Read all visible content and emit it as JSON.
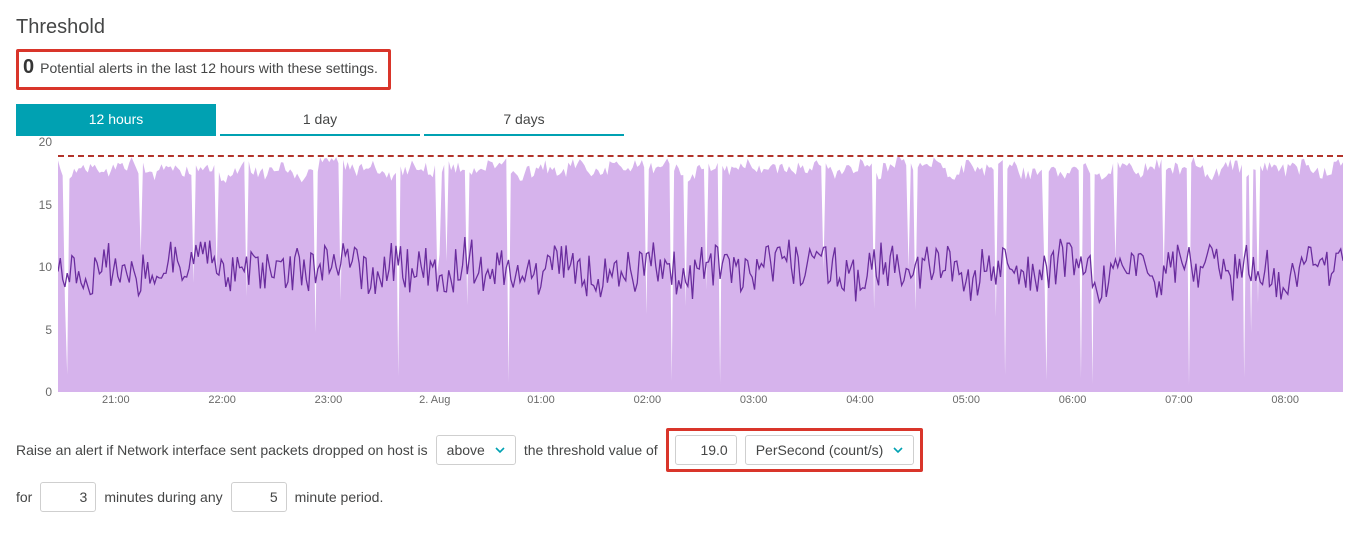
{
  "title": "Threshold",
  "alert": {
    "count": "0",
    "text": "Potential alerts in the last 12 hours with these settings."
  },
  "tabs": [
    {
      "label": "12 hours",
      "active": true
    },
    {
      "label": "1 day",
      "active": false
    },
    {
      "label": "7 days",
      "active": false
    }
  ],
  "chart_data": {
    "type": "line",
    "title": "",
    "xlabel": "",
    "ylabel": "",
    "ylim": [
      0,
      20
    ],
    "y_ticks": [
      0,
      5,
      10,
      15,
      20
    ],
    "x_ticks": [
      "21:00",
      "22:00",
      "23:00",
      "2. Aug",
      "01:00",
      "02:00",
      "03:00",
      "04:00",
      "05:00",
      "06:00",
      "07:00",
      "08:00"
    ],
    "threshold": 19.0,
    "series": [
      {
        "name": "range",
        "role": "area-max",
        "values": [
          18.6,
          17.9,
          18.8,
          18.2,
          18.9,
          18.0,
          18.7,
          18.3,
          18.9,
          17.8,
          18.8,
          18.1,
          18.9,
          17.7,
          18.8,
          18.9,
          18.2,
          18.9,
          17.6,
          18.8,
          18.3,
          18.9,
          18.0,
          18.7,
          18.9,
          17.9,
          18.8,
          18.2,
          18.9,
          18.1,
          18.7,
          18.9,
          18.4,
          18.9,
          17.8,
          18.8,
          18.2,
          18.9,
          18.0,
          18.7,
          18.3,
          18.9,
          17.9,
          18.8,
          18.1,
          18.9,
          18.5,
          18.8,
          17.8,
          18.9,
          18.3,
          18.8,
          18.0,
          18.9,
          18.2,
          18.7,
          17.9,
          18.9,
          18.1,
          18.8,
          18.4,
          18.9,
          17.8,
          18.8,
          18.0,
          18.9,
          18.3,
          18.7,
          18.1,
          18.9
        ]
      },
      {
        "name": "mean",
        "role": "line",
        "values": [
          9.5,
          10.1,
          9.2,
          10.5,
          9.8,
          8.9,
          10.3,
          9.6,
          11.0,
          9.1,
          10.4,
          9.7,
          8.8,
          10.2,
          9.4,
          11.1,
          9.9,
          8.7,
          10.6,
          9.5,
          10.0,
          9.3,
          11.2,
          8.9,
          10.4,
          9.8,
          9.1,
          10.7,
          9.6,
          8.8,
          10.2,
          9.4,
          10.9,
          9.7,
          8.9,
          10.5,
          9.3,
          10.1,
          9.8,
          11.0,
          9.2,
          10.6,
          9.5,
          8.8,
          10.3,
          9.9,
          9.1,
          10.8,
          9.6,
          8.9,
          10.4,
          9.7,
          10.0,
          9.3,
          11.1,
          9.5,
          8.8,
          10.6,
          9.8,
          9.2,
          10.3,
          9.6,
          10.9,
          9.0,
          10.5,
          9.7,
          8.9,
          10.2,
          9.4,
          10.7
        ]
      }
    ]
  },
  "rule": {
    "prefix": "Raise an alert if Network interface sent packets dropped on host is",
    "operator": "above",
    "mid": "the threshold value of",
    "threshold_value": "19.0",
    "unit": "PerSecond (count/s)",
    "for_label": "for",
    "minutes": "3",
    "minutes_label": "minutes during any",
    "window": "5",
    "window_label": "minute period."
  }
}
